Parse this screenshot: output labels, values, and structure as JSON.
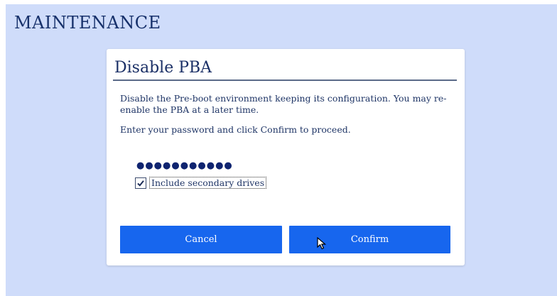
{
  "screen": {
    "title": "MAINTENANCE"
  },
  "dialog": {
    "title": "Disable PBA",
    "description": "Disable the Pre-boot environment keeping its configuration. You may re-enable the PBA at a later time.",
    "instruction": "Enter your password and click Confirm to proceed.",
    "password_mask": "●●●●●●●●●●●",
    "include_secondary": {
      "label": "Include secondary drives",
      "checked": true
    },
    "buttons": {
      "cancel": "Cancel",
      "confirm": "Confirm"
    }
  },
  "colors": {
    "background": "#cfdcfa",
    "button": "#1766ee",
    "text": "#1f3566"
  },
  "icons": {
    "checkbox": "checkmark-icon",
    "cursor": "mouse-pointer-icon"
  }
}
